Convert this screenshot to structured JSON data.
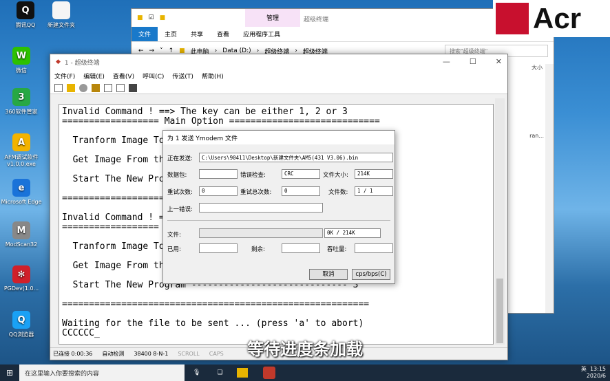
{
  "desktop_icons": [
    {
      "label": "腾讯QQ",
      "glyph": "Q",
      "color": "#111"
    },
    {
      "label": "新建文件夹",
      "glyph": "",
      "color": "#f5f5f5"
    },
    {
      "label": "微信",
      "glyph": "W",
      "color": "#2dc100"
    },
    {
      "label": "360软件管家",
      "glyph": "3",
      "color": "#27a844"
    },
    {
      "label": "AFM调试软件v1.0.0.exe",
      "glyph": "A",
      "color": "#f3b300"
    },
    {
      "label": "Microsoft Edge",
      "glyph": "e",
      "color": "#1a73d9"
    },
    {
      "label": "ModScan32",
      "glyph": "M",
      "color": "#888"
    },
    {
      "label": "PGDev(1.0...",
      "glyph": "✻",
      "color": "#d0202a"
    },
    {
      "label": "QQ浏览器",
      "glyph": "Q",
      "color": "#1aa1f5"
    }
  ],
  "explorer": {
    "manage_tab": "管理",
    "folder_title": "超级终端",
    "ribbon": [
      "文件",
      "主页",
      "共享",
      "查看",
      "应用程序工具"
    ],
    "path": [
      "此电脑",
      "Data (D:)",
      "超级终端",
      "超级终端"
    ],
    "search_placeholder": "搜索\"超级终端\"",
    "size_col": "大小",
    "partial_item": "ran..."
  },
  "terminal": {
    "title": "1 - 超级终端",
    "menu": [
      "文件(F)",
      "编辑(E)",
      "查看(V)",
      "呼叫(C)",
      "传送(T)",
      "帮助(H)"
    ],
    "lines": [
      "Invalid Command ! ==> The key can be either 1, 2 or 3",
      "================== Main Option ============================",
      "",
      "  Tranform Image To",
      "",
      "  Get Image From th",
      "",
      "  Start The New Pro",
      "",
      "=========================================================",
      "",
      "Invalid Command ! =",
      "==================",
      "",
      "  Tranform Image To",
      "",
      "  Get Image From th",
      "",
      "  Start The New Program ----------------------------- 3",
      "",
      "=========================================================",
      "",
      "Waiting for the file to be sent ... (press 'a' to abort)",
      "CCCCCC_"
    ],
    "status": {
      "connected": "已连接 0:00:36",
      "detect": "自动检测",
      "baud": "38400 8-N-1",
      "scroll": "SCROLL",
      "caps": "CAPS"
    }
  },
  "dialog": {
    "title": "为 1 发送 Ymodem 文件",
    "sending_label": "正在发送:",
    "sending_value": "C:\\Users\\90411\\Desktop\\新建文件夹\\AM5(431 V3.06).bin",
    "packet_label": "数据包:",
    "packet_value": "",
    "errcheck_label": "错误检查:",
    "errcheck_value": "CRC",
    "filesize_label": "文件大小:",
    "filesize_value": "214K",
    "retries_label": "重试次数:",
    "retries_value": "0",
    "total_retries_label": "重试总次数:",
    "total_retries_value": "0",
    "files_label": "文件数:",
    "files_value": "1 / 1",
    "last_error_label": "上一错误:",
    "last_error_value": "",
    "file_label": "文件:",
    "file_progress": 0,
    "file_progress_text": "0K / 214K",
    "elapsed_label": "已用:",
    "elapsed_value": "",
    "remaining_label": "剩余:",
    "remaining_value": "",
    "throughput_label": "吞吐量:",
    "throughput_value": "",
    "cancel_button": "取消",
    "cps_button": "cps/bps(C)"
  },
  "taskbar": {
    "search_placeholder": "在这里输入你要搜索的内容",
    "ime": "英",
    "time": "13:15",
    "date": "2020/6"
  },
  "brand_text": "Acr",
  "subtitle": "等待进度条加载"
}
